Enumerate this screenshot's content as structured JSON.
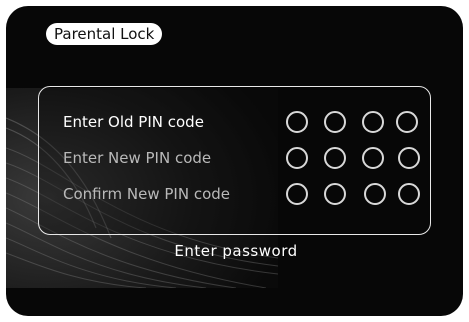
{
  "header": {
    "title": "Parental Lock"
  },
  "pin_form": {
    "rows": [
      {
        "label": "Enter Old PIN code",
        "digits_entered": 0,
        "digits_total": 4,
        "active": true
      },
      {
        "label": "Enter New PIN code",
        "digits_entered": 0,
        "digits_total": 4,
        "active": false
      },
      {
        "label": "Confirm New PIN code",
        "digits_entered": 0,
        "digits_total": 4,
        "active": false
      }
    ]
  },
  "footer": {
    "hint": "Enter password"
  },
  "colors": {
    "background": "#070707",
    "text_active": "#ffffff",
    "text_inactive": "#b9b9b9",
    "panel_border": "#e8e8e8"
  }
}
